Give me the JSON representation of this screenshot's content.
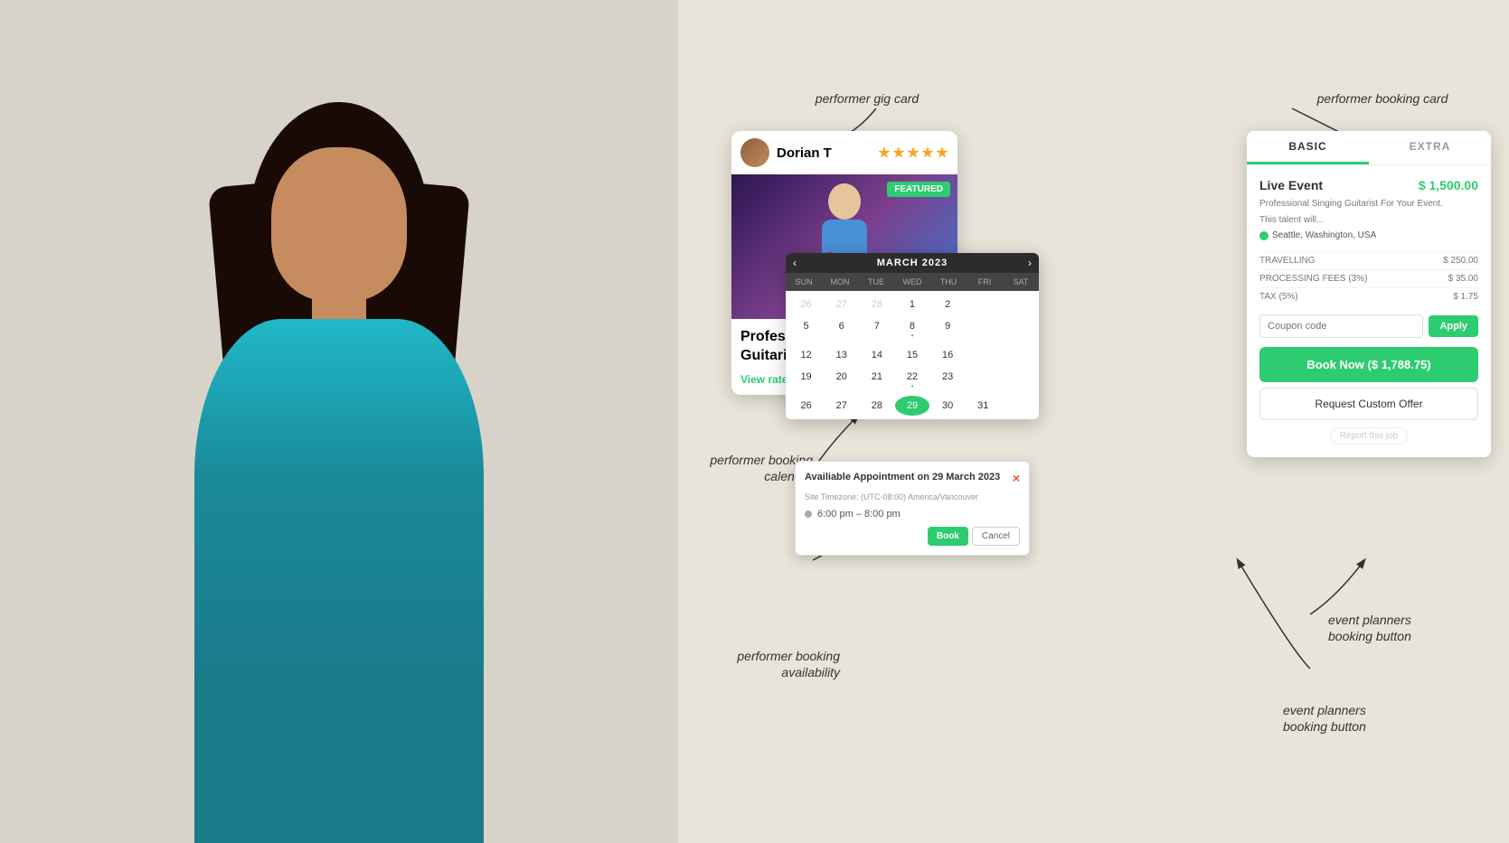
{
  "background_color": "#e8e4d9",
  "annotations": {
    "gig_card_label": "performer gig card",
    "booking_card_label": "performer booking card",
    "calendar_label": "performer booking\ncalendar",
    "availability_label": "performer booking\navailability",
    "booking_btn_label1": "event planners\nbooking button",
    "booking_btn_label2": "event planners\nbooking button"
  },
  "gig_card": {
    "performer_name": "Dorian T",
    "featured_badge": "FEATURED",
    "title": "Professional Si...\nGuitarist For Yo...",
    "view_rates": "View rates & availability",
    "stars": 5
  },
  "booking_card": {
    "tab_basic": "BASIC",
    "tab_extra": "EXTRA",
    "service_name": "Live Event",
    "price": "$ 1,500.00",
    "description": "Professional Singing Guitarist For Your Event.",
    "sub_description": "This talent will...",
    "location": "Seattle, Washington, USA",
    "travelling_label": "TRAVELLING",
    "travelling_value": "$ 250.00",
    "processing_label": "PROCESSING FEES (3%)",
    "processing_value": "$ 35.00",
    "tax_label": "TAX (5%)",
    "tax_value": "$ 1.75",
    "coupon_placeholder": "Coupon code",
    "apply_label": "Apply",
    "book_now_label": "Book Now ($ 1,788.75)",
    "request_custom_label": "Request Custom Offer",
    "report_label": "Report this job"
  },
  "calendar": {
    "month": "MARCH 2023",
    "days_header": [
      "SUN",
      "MON",
      "TUE",
      "WED",
      "THU",
      "FRI",
      "SAT"
    ],
    "nav_prev": "‹",
    "nav_next": "›",
    "weeks": [
      [
        "26",
        "27",
        "28",
        "1",
        "2",
        "",
        ""
      ],
      [
        "5",
        "6",
        "7",
        "8",
        "9",
        "",
        ""
      ],
      [
        "12",
        "13",
        "14",
        "15",
        "16",
        "",
        ""
      ],
      [
        "19",
        "20",
        "21",
        "22",
        "23",
        "",
        ""
      ],
      [
        "26",
        "27",
        "28",
        "29",
        "30",
        "31",
        ""
      ]
    ]
  },
  "availability_popup": {
    "title": "Availiable Appointment on 29 March 2023",
    "subtitle": "Site Timezone: (UTC-08:00) America/Vancouver",
    "time_slot": "6:00 pm – 8:00 pm",
    "book_label": "Book",
    "cancel_label": "Cancel"
  }
}
